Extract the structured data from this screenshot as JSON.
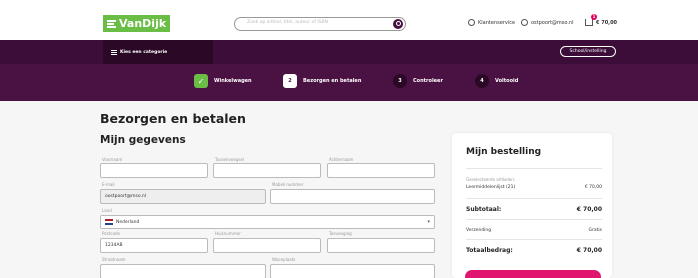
{
  "header": {
    "logo_text": "VanDijk",
    "search_placeholder": "Zoek op artikel, titel, auteur of ISBN",
    "customer_service": "Klantenservice",
    "account_email": "ostpoort@mso.nl",
    "cart_count": "1",
    "cart_total": "€ 70,00"
  },
  "nav": {
    "category_label": "Kies een categorie",
    "school_button": "School/instelling"
  },
  "steps": [
    {
      "num": "✓",
      "label": "Winkelwagen",
      "state": "done"
    },
    {
      "num": "2",
      "label": "Bezorgen en betalen",
      "state": "active"
    },
    {
      "num": "3",
      "label": "Controleer",
      "state": "todo"
    },
    {
      "num": "4",
      "label": "Voltooid",
      "state": "todo"
    }
  ],
  "page": {
    "title": "Bezorgen en betalen",
    "section_title": "Mijn gegevens"
  },
  "form": {
    "voornaam_label": "Voornaam",
    "voornaam_value": "",
    "tussenvoegsel_label": "Tussenvoegsel",
    "tussenvoegsel_value": "",
    "achternaam_label": "Achternaam",
    "achternaam_value": "",
    "email_label": "E-mail",
    "email_value": "oostpoort@mso.nl",
    "mobiel_label": "Mobiel nummer",
    "mobiel_value": "",
    "land_label": "Land",
    "land_value": "Nederland",
    "postcode_label": "Postcode",
    "postcode_value": "1234AB",
    "huisnummer_label": "Huisnummer",
    "huisnummer_value": "",
    "toevoeging_label": "Toevoeging",
    "toevoeging_value": "",
    "straatnaam_label": "Straatnaam",
    "woonplaats_label": "Woonplaats"
  },
  "order": {
    "title": "Mijn bestelling",
    "items_heading": "Geselecteerde artikelen:",
    "item_name": "Leermiddelenlijst (21)",
    "item_price": "€ 70,00",
    "subtotal_label": "Subtotaal:",
    "subtotal_value": "€ 70,00",
    "shipping_label": "Verzending",
    "shipping_value": "Gratis",
    "total_label": "Totaalbedrag:",
    "total_value": "€ 70,00"
  },
  "colors": {
    "brand_green": "#6abd45",
    "brand_purple": "#3c0d38",
    "accent_pink": "#e0156f"
  }
}
